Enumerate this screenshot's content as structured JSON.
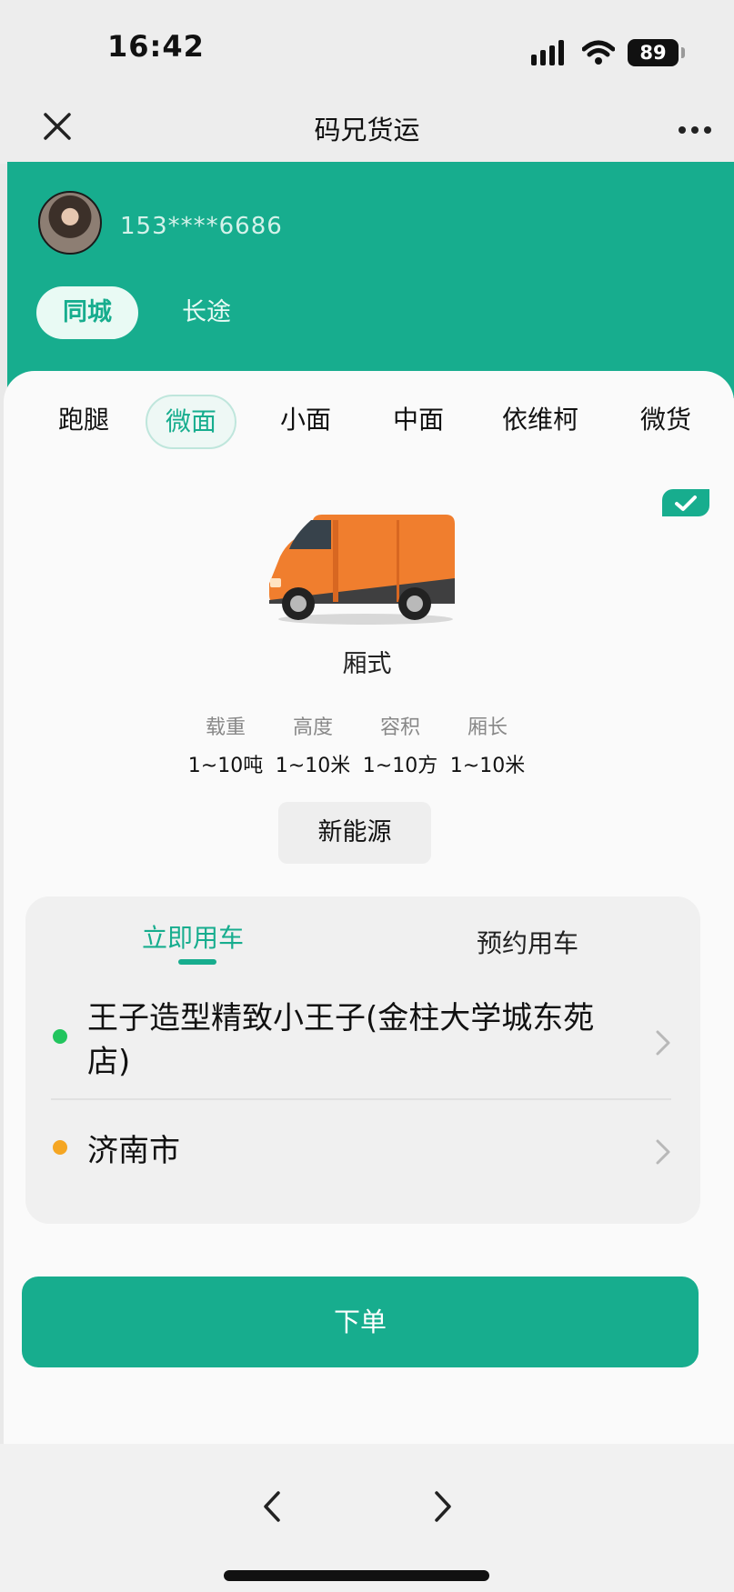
{
  "status_bar": {
    "time": "16:42",
    "battery": "89"
  },
  "title_bar": {
    "title": "码兄货运"
  },
  "user": {
    "phone": "153****6686"
  },
  "service_tabs": [
    "同城",
    "长途"
  ],
  "vehicle_tabs": [
    "跑腿",
    "微面",
    "小面",
    "中面",
    "依维柯",
    "微货"
  ],
  "vehicle": {
    "type": "厢式",
    "specs": [
      {
        "label": "载重",
        "value": "1~10吨"
      },
      {
        "label": "高度",
        "value": "1~10米"
      },
      {
        "label": "容积",
        "value": "1~10方"
      },
      {
        "label": "厢长",
        "value": "1~10米"
      }
    ],
    "energy": "新能源"
  },
  "order": {
    "tabs": [
      "立即用车",
      "预约用车"
    ],
    "from_address": "王子造型精致小王子(金柱大学城东苑店)",
    "to_address": "济南市"
  },
  "submit": "下单",
  "colors": {
    "accent": "#17ad8e",
    "from_dot": "#22c55e",
    "to_dot": "#f5a623"
  }
}
